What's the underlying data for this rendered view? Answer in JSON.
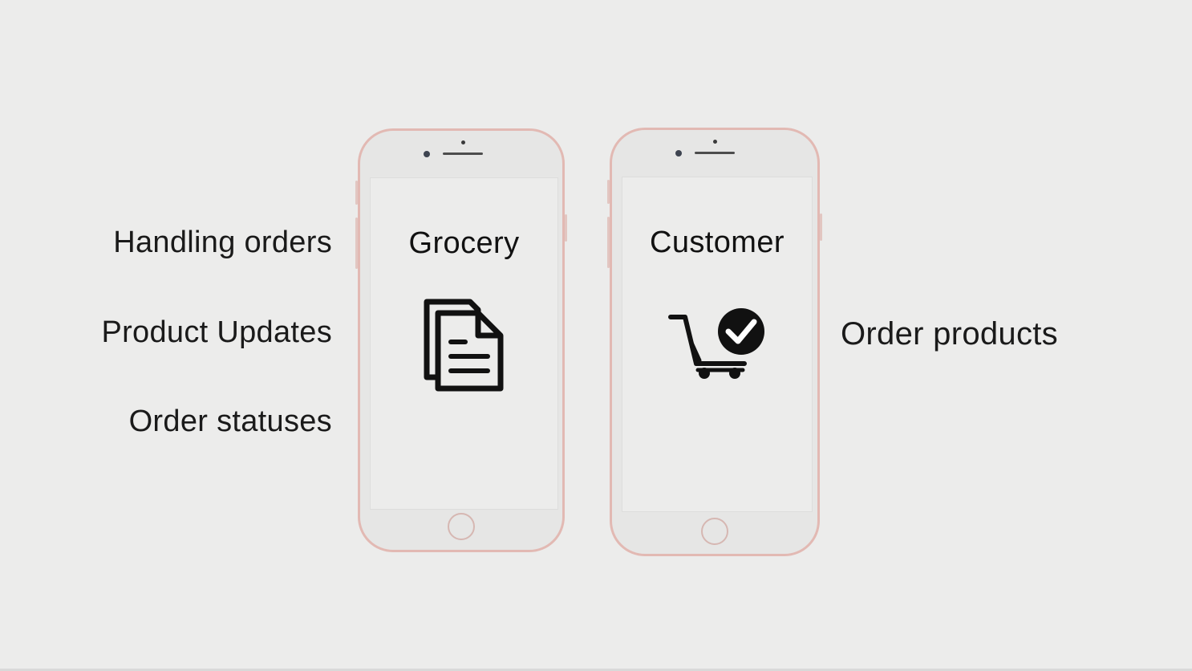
{
  "left_features": [
    "Handling orders",
    "Product Updates",
    "Order statuses"
  ],
  "right_features": [
    "Order products"
  ],
  "phones": [
    {
      "title": "Grocery",
      "icon": "documents-icon"
    },
    {
      "title": "Customer",
      "icon": "cart-check-icon"
    }
  ],
  "colors": {
    "background": "#ececeb",
    "phone_frame": "#e2b9b3",
    "icon": "#111111"
  }
}
